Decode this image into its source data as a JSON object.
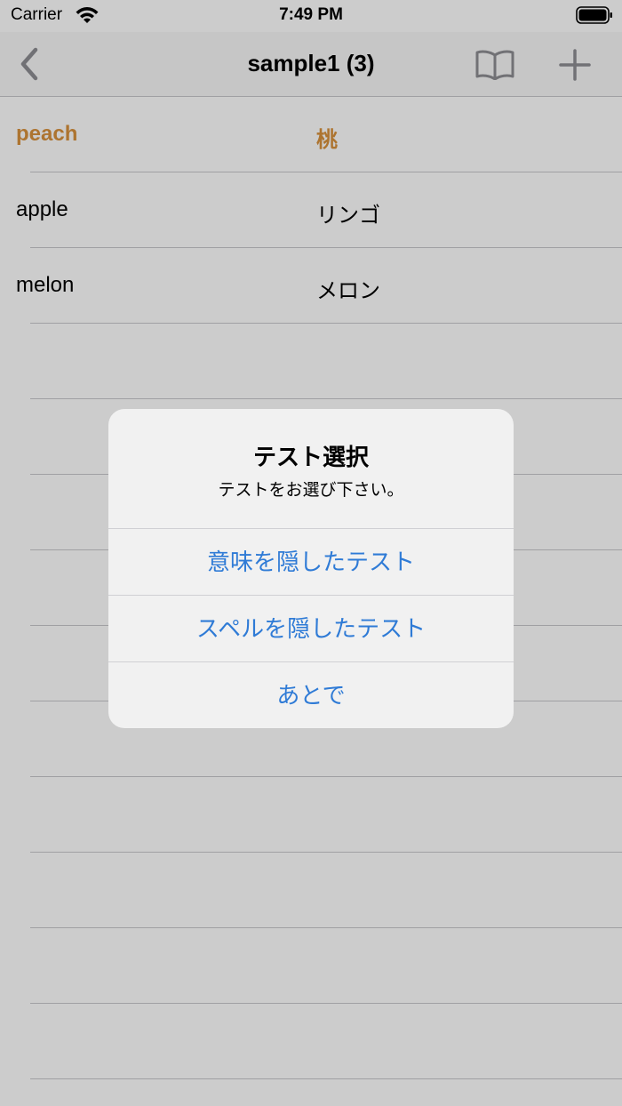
{
  "status_bar": {
    "carrier": "Carrier",
    "time": "7:49 PM"
  },
  "nav": {
    "title": "sample1 (3)",
    "back_icon": "chevron-left-icon",
    "book_icon": "book-icon",
    "add_icon": "plus-icon",
    "icon_color": "#8e8e93"
  },
  "list": {
    "rows": [
      {
        "english": "peach",
        "japanese": "桃",
        "highlighted": true
      },
      {
        "english": "apple",
        "japanese": "リンゴ",
        "highlighted": false
      },
      {
        "english": "melon",
        "japanese": "メロン",
        "highlighted": false
      }
    ],
    "highlight_color": "#d9913c"
  },
  "alert": {
    "title": "テスト選択",
    "message": "テストをお選び下さい。",
    "actions": [
      {
        "label": "意味を隠したテスト"
      },
      {
        "label": "スペルを隠したテスト"
      },
      {
        "label": "あとで"
      }
    ],
    "action_color": "#2f7bd6"
  }
}
